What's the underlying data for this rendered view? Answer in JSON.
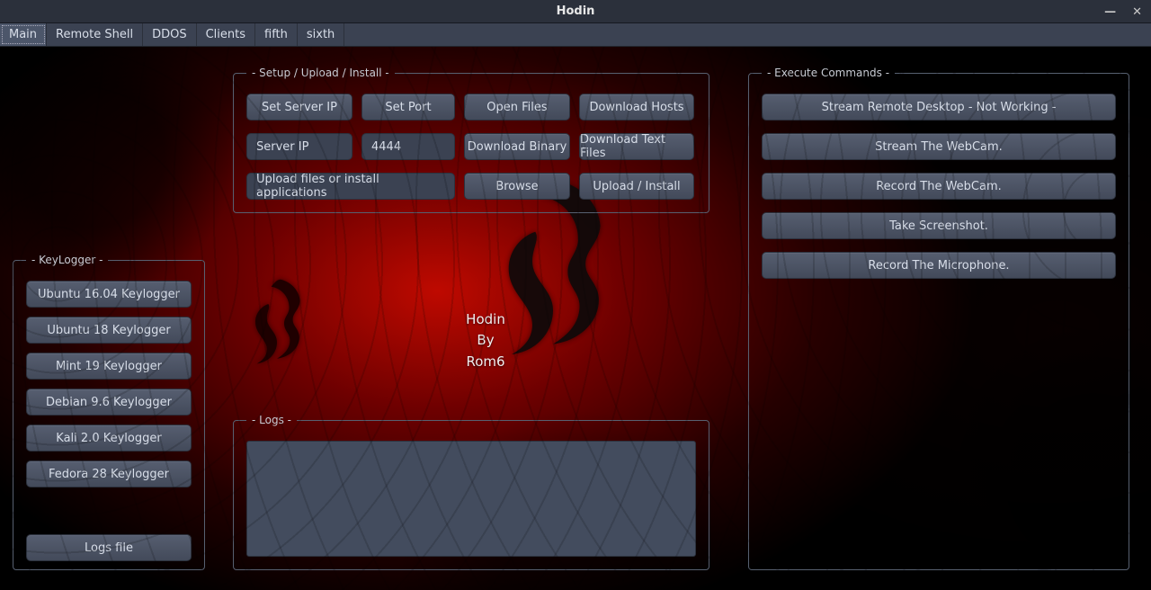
{
  "window": {
    "title": "Hodin"
  },
  "tabs": [
    {
      "label": "Main",
      "active": true
    },
    {
      "label": "Remote Shell",
      "active": false
    },
    {
      "label": "DDOS",
      "active": false
    },
    {
      "label": "Clients",
      "active": false
    },
    {
      "label": "fifth",
      "active": false
    },
    {
      "label": "sixth",
      "active": false
    }
  ],
  "setup": {
    "legend": "- Setup / Upload / Install -",
    "set_server_ip": "Set Server IP",
    "set_port": "Set Port",
    "open_files": "Open Files",
    "download_hosts": "Download Hosts",
    "server_ip_value": "Server IP",
    "port_value": "4444",
    "download_binary": "Download Binary",
    "download_text": "Download Text Files",
    "upload_path_value": "Upload files or install applications",
    "browse": "Browse",
    "upload_install": "Upload / Install"
  },
  "exec": {
    "legend": "- Execute Commands -",
    "stream_desktop": "Stream Remote Desktop - Not Working -",
    "stream_webcam": "Stream The WebCam.",
    "record_webcam": "Record The WebCam.",
    "take_screenshot": "Take Screenshot.",
    "record_mic": "Record The Microphone."
  },
  "keylogger": {
    "legend": "- KeyLogger -",
    "items": [
      "Ubuntu 16.04 Keylogger",
      "Ubuntu 18 Keylogger",
      "Mint 19 Keylogger",
      "Debian 9.6 Keylogger",
      "Kali 2.0 Keylogger",
      "Fedora 28 Keylogger"
    ],
    "logs_file": "Logs file"
  },
  "logs": {
    "legend": "- Logs -"
  },
  "credit": {
    "line1": "Hodin",
    "line2": "By",
    "line3": "Rom6"
  }
}
